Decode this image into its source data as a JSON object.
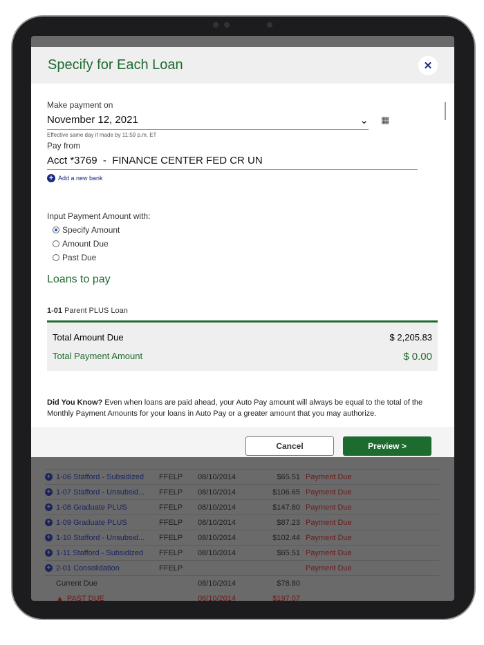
{
  "modal": {
    "title": "Specify for Each Loan",
    "close_icon": "close-icon",
    "make_payment_label": "Make payment on",
    "payment_date": "November 12, 2021",
    "date_hint": "Effective same day if made by 11:59 p.m. ET",
    "pay_from_label": "Pay from",
    "pay_from_value": "Acct *3769  -  FINANCE CENTER FED CR UN",
    "add_bank": "Add a new bank",
    "input_with_label": "Input Payment Amount with:",
    "options": [
      {
        "label": "Specify Amount",
        "selected": true
      },
      {
        "label": "Amount Due",
        "selected": false
      },
      {
        "label": "Past Due",
        "selected": false
      }
    ],
    "loans_heading": "Loans to pay",
    "loan_id": "1-01",
    "loan_name": "Parent PLUS Loan",
    "total_due_label": "Total Amount Due",
    "total_due": "$ 2,205.83",
    "total_payment_label": "Total Payment Amount",
    "total_payment": "$ 0.00",
    "dyk_bold": "Did You Know?",
    "dyk_text": " Even when loans are paid ahead, your Auto Pay amount will always be equal to the total of the Monthly Payment Amounts for your loans in Auto Pay or a greater amount that you may authorize.",
    "cancel": "Cancel",
    "preview": "Preview >"
  },
  "background_rows": [
    {
      "name": "1-06 Stafford - Subsidized",
      "type": "FFELP",
      "date": "08/10/2014",
      "amount": "$65.51",
      "status": "Payment Due"
    },
    {
      "name": "1-07 Stafford - Unsubsid...",
      "type": "FFELP",
      "date": "08/10/2014",
      "amount": "$106.65",
      "status": "Payment Due"
    },
    {
      "name": "1-08 Graduate PLUS",
      "type": "FFELP",
      "date": "08/10/2014",
      "amount": "$147.80",
      "status": "Payment Due"
    },
    {
      "name": "1-09 Graduate PLUS",
      "type": "FFELP",
      "date": "08/10/2014",
      "amount": "$87.23",
      "status": "Payment Due"
    },
    {
      "name": "1-10 Stafford - Unsubsid...",
      "type": "FFELP",
      "date": "08/10/2014",
      "amount": "$102.44",
      "status": "Payment Due"
    },
    {
      "name": "1-11 Stafford - Subsidized",
      "type": "FFELP",
      "date": "08/10/2014",
      "amount": "$65.51",
      "status": "Payment Due"
    },
    {
      "name": "2-01 Consolidation",
      "type": "FFELP",
      "date": "",
      "amount": "",
      "status": "Payment Due"
    }
  ],
  "sub_rows": [
    {
      "label": "Current Due",
      "date": "08/10/2014",
      "amount": "$78.80"
    },
    {
      "label": "PAST DUE",
      "date": "06/10/2014",
      "amount": "$197.07"
    }
  ]
}
